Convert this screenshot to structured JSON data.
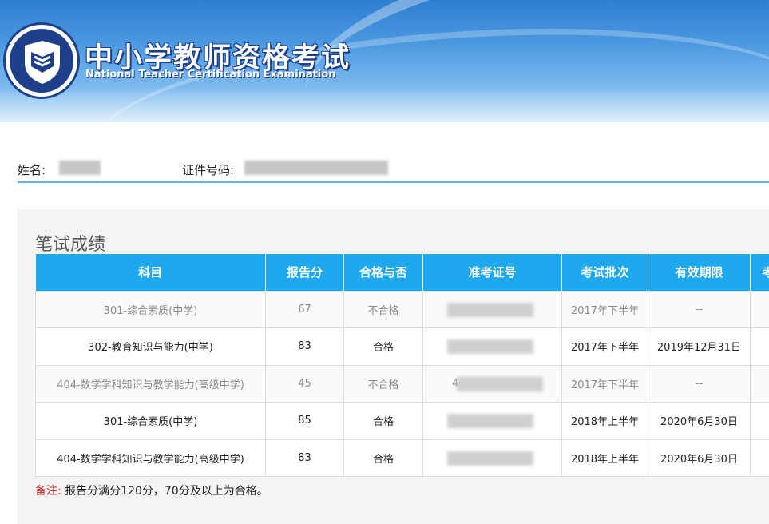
{
  "header": {
    "title_cn": "中小学教师资格考试",
    "title_en": "National Teacher Certification Examination"
  },
  "identity": {
    "name_label": "姓名:",
    "id_label": "证件号码:"
  },
  "scores": {
    "section_title": "笔试成绩",
    "columns": [
      "科目",
      "报告分",
      "合格与否",
      "准考证号",
      "考试批次",
      "有效期限",
      "考"
    ],
    "rows": [
      {
        "subject": "301-综合素质(中学)",
        "score": "67",
        "pass": "不合格",
        "ticket": "",
        "batch": "2017年下半年",
        "valid": "--",
        "status": "fail"
      },
      {
        "subject": "302-教育知识与能力(中学)",
        "score": "83",
        "pass": "合格",
        "ticket": "",
        "batch": "2017年下半年",
        "valid": "2019年12月31日",
        "status": "pass"
      },
      {
        "subject": "404-数学学科知识与教学能力(高级中学)",
        "score": "45",
        "pass": "不合格",
        "ticket": "4",
        "batch": "2017年下半年",
        "valid": "--",
        "status": "fail"
      },
      {
        "subject": "301-综合素质(中学)",
        "score": "85",
        "pass": "合格",
        "ticket": "",
        "batch": "2018年上半年",
        "valid": "2020年6月30日",
        "status": "pass"
      },
      {
        "subject": "404-数学学科知识与教学能力(高级中学)",
        "score": "83",
        "pass": "合格",
        "ticket": "",
        "batch": "2018年上半年",
        "valid": "2020年6月30日",
        "status": "pass"
      }
    ]
  },
  "note": {
    "label": "备注:",
    "text": "报告分满分120分，70分及以上为合格。"
  },
  "colors": {
    "header_blue": "#1ea8ee",
    "note_red": "#d6201f"
  }
}
